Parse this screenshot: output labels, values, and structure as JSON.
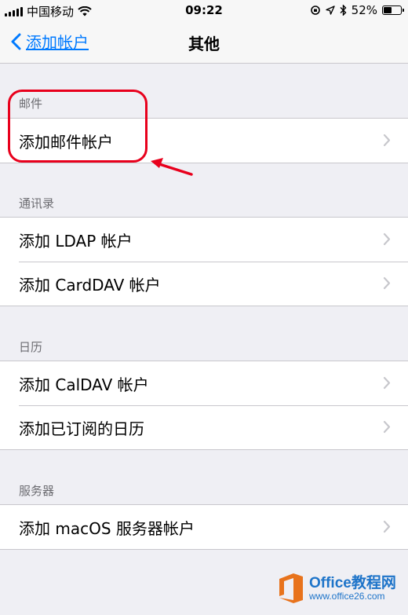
{
  "status_bar": {
    "carrier": "中国移动",
    "time": "09:22",
    "battery_percent": "52%",
    "battery_level": 0.52
  },
  "nav": {
    "back_label": "添加帐户",
    "title": "其他"
  },
  "sections": [
    {
      "header": "邮件",
      "items": [
        {
          "label": "添加邮件帐户"
        }
      ]
    },
    {
      "header": "通讯录",
      "items": [
        {
          "label": "添加 LDAP 帐户"
        },
        {
          "label": "添加 CardDAV 帐户"
        }
      ]
    },
    {
      "header": "日历",
      "items": [
        {
          "label": "添加 CalDAV 帐户"
        },
        {
          "label": "添加已订阅的日历"
        }
      ]
    },
    {
      "header": "服务器",
      "items": [
        {
          "label": "添加 macOS 服务器帐户"
        }
      ]
    }
  ],
  "annotation_color": "#e8001c",
  "accent_color": "#007aff",
  "watermark": {
    "title": "Office教程网",
    "url": "www.office26.com"
  }
}
